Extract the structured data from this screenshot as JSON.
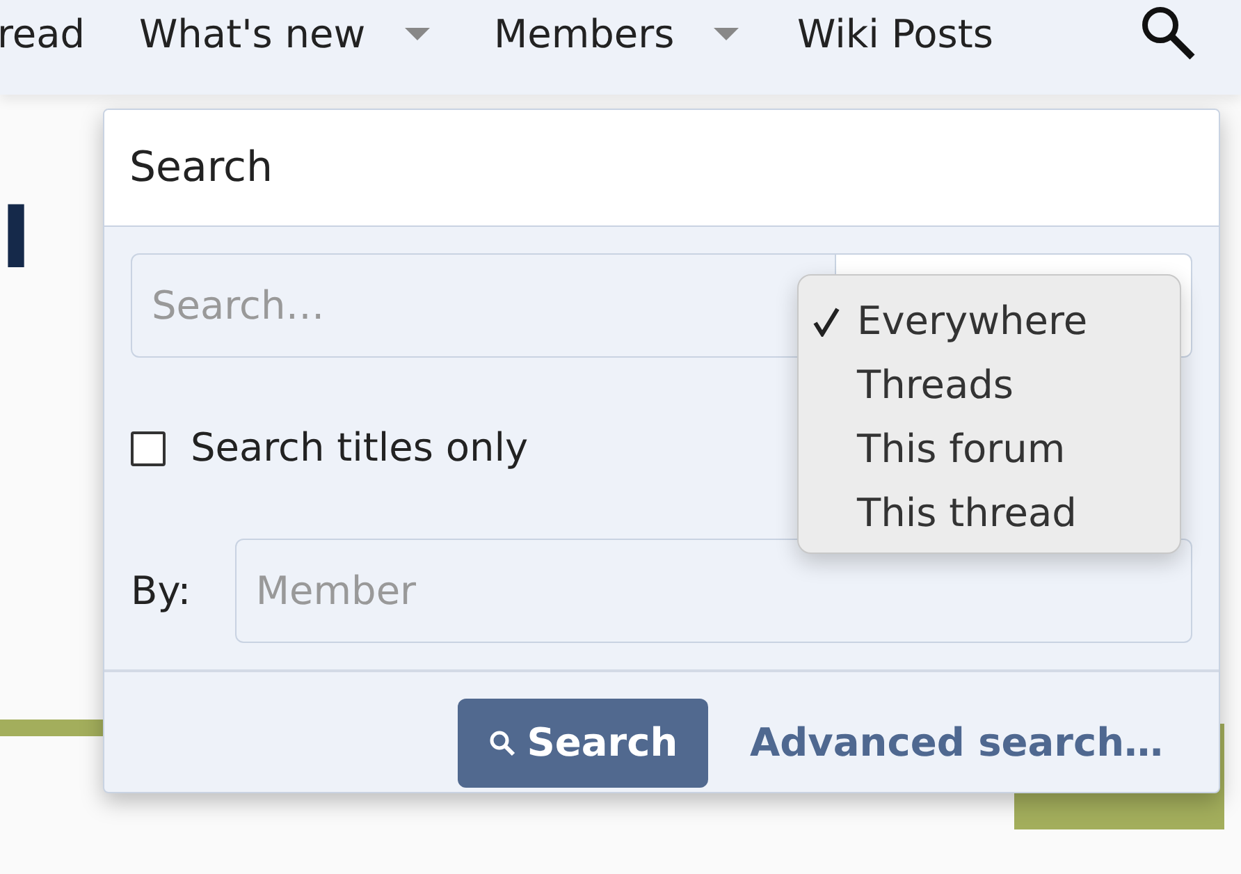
{
  "nav": {
    "items": [
      {
        "label": "read",
        "dropdown": false
      },
      {
        "label": "What's new",
        "dropdown": true
      },
      {
        "label": "Members",
        "dropdown": true
      },
      {
        "label": "Wiki Posts",
        "dropdown": false
      }
    ]
  },
  "page": {
    "heading": "I"
  },
  "search_popup": {
    "title": "Search",
    "query": {
      "placeholder": "Search…"
    },
    "scope_menu": {
      "options": [
        {
          "label": "Everywhere",
          "selected": true
        },
        {
          "label": "Threads",
          "selected": false
        },
        {
          "label": "This forum",
          "selected": false
        },
        {
          "label": "This thread",
          "selected": false
        }
      ]
    },
    "titles_only": {
      "label": "Search titles only",
      "checked": false
    },
    "member": {
      "label": "By:",
      "placeholder": "Member"
    },
    "search_button": "Search",
    "advanced_link": "Advanced search…"
  }
}
